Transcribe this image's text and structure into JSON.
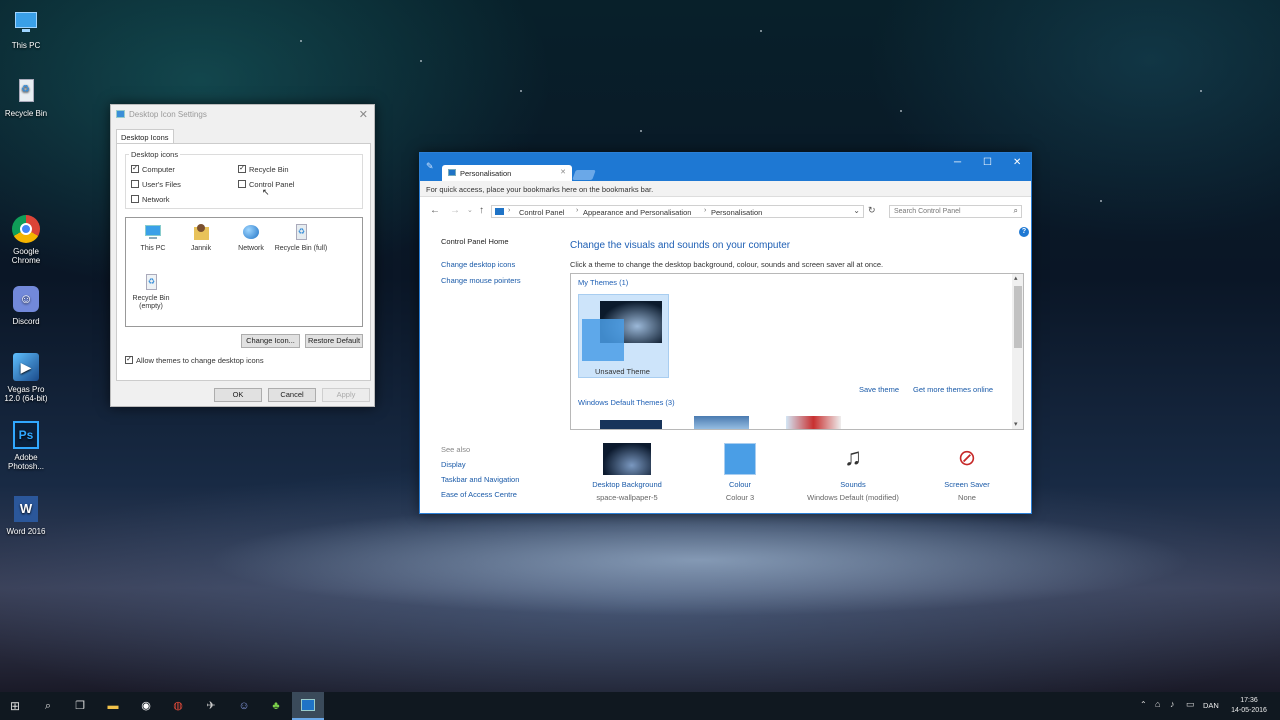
{
  "desktop": {
    "icons": [
      {
        "label": "This PC"
      },
      {
        "label": "Recycle Bin"
      },
      {
        "label": "Google Chrome"
      },
      {
        "label": "Discord"
      },
      {
        "label": "Vegas Pro 12.0 (64-bit)"
      },
      {
        "label": "Adobe Photosh..."
      },
      {
        "label": "Word 2016"
      }
    ]
  },
  "dialog": {
    "title": "Desktop Icon Settings",
    "tab": "Desktop Icons",
    "group_label": "Desktop icons",
    "checks": [
      {
        "label": "Computer",
        "checked": true
      },
      {
        "label": "Recycle Bin",
        "checked": true
      },
      {
        "label": "User's Files",
        "checked": false
      },
      {
        "label": "Control Panel",
        "checked": false
      },
      {
        "label": "Network",
        "checked": false
      }
    ],
    "icons": [
      {
        "label": "This PC",
        "icon": "monitor-icon"
      },
      {
        "label": "Jannik",
        "icon": "user-folder-icon"
      },
      {
        "label": "Network",
        "icon": "network-icon"
      },
      {
        "label": "Recycle Bin (full)",
        "icon": "recycle-bin-full-icon"
      },
      {
        "label": "Recycle Bin (empty)",
        "icon": "recycle-bin-empty-icon"
      }
    ],
    "change_icon": "Change Icon...",
    "restore_default": "Restore Default",
    "allow_themes": "Allow themes to change desktop icons",
    "allow_themes_checked": true,
    "ok": "OK",
    "cancel": "Cancel",
    "apply": "Apply"
  },
  "cp": {
    "tab_title": "Personalisation",
    "bookmarks_hint": "For quick access, place your bookmarks here on the bookmarks bar.",
    "breadcrumb": [
      "Control Panel",
      "Appearance and Personalisation",
      "Personalisation"
    ],
    "search_placeholder": "Search Control Panel",
    "side_links": [
      "Control Panel Home",
      "Change desktop icons",
      "Change mouse pointers"
    ],
    "see_also": "See also",
    "see_also_links": [
      "Display",
      "Taskbar and Navigation",
      "Ease of Access Centre"
    ],
    "heading": "Change the visuals and sounds on your computer",
    "subheading": "Click a theme to change the desktop background, colour, sounds and screen saver all at once.",
    "my_themes": "My Themes (1)",
    "unsaved_theme": "Unsaved Theme",
    "save_theme": "Save theme",
    "more_themes": "Get more themes online",
    "default_themes": "Windows Default Themes (3)",
    "bottom": [
      {
        "label": "Desktop Background",
        "value": "space-wallpaper-5"
      },
      {
        "label": "Colour",
        "value": "Colour 3"
      },
      {
        "label": "Sounds",
        "value": "Windows Default (modified)"
      },
      {
        "label": "Screen Saver",
        "value": "None"
      }
    ]
  },
  "taskbar": {
    "lang": "DAN",
    "time": "17:36",
    "date": "14-05-2016"
  },
  "colors": {
    "accent": "#1e78d3",
    "link": "#1a5aa8",
    "heading": "#1e5fb4"
  }
}
